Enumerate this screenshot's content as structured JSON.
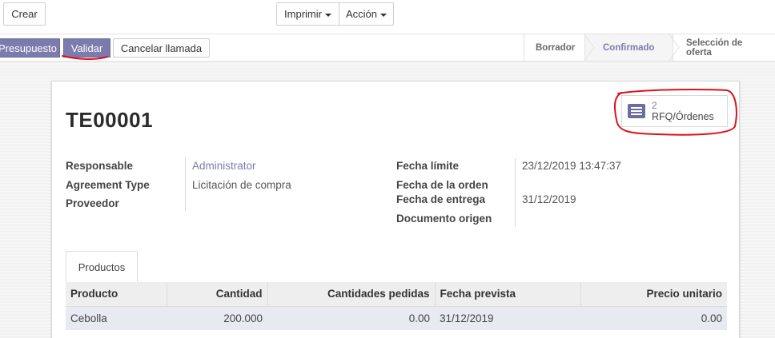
{
  "toolbar": {
    "create_label": "Crear",
    "print_label": "Imprimir",
    "action_label": "Acción"
  },
  "statusbar": {
    "quote_label": "Presupuesto",
    "validate_label": "Validar",
    "cancel_label": "Cancelar llamada",
    "stages": [
      {
        "label": "Borrador",
        "active": false
      },
      {
        "label": "Confirmado",
        "active": true
      },
      {
        "label": "Selección de oferta",
        "active": false
      }
    ]
  },
  "record": {
    "name": "TE00001",
    "smart_button": {
      "count": "2",
      "label": "RFQ/Órdenes",
      "icon": "list-icon"
    },
    "left_fields": [
      {
        "label": "Responsable",
        "value": "Administrator"
      },
      {
        "label": "Agreement Type",
        "value": "Licitación de compra"
      },
      {
        "label": "Proveedor",
        "value": ""
      }
    ],
    "right_fields": [
      {
        "label": "Fecha límite",
        "value": "23/12/2019 13:47:37"
      },
      {
        "label": "Fecha de la orden",
        "value": ""
      },
      {
        "label": "Fecha de entrega",
        "value": "31/12/2019"
      },
      {
        "label": "Documento origen",
        "value": ""
      }
    ]
  },
  "tabs": [
    {
      "label": "Productos"
    }
  ],
  "lines": {
    "columns": [
      "Producto",
      "Cantidad",
      "Cantidades pedidas",
      "Fecha prevista",
      "Precio unitario"
    ],
    "rows": [
      [
        "Cebolla",
        "200.000",
        "0.00",
        "31/12/2019",
        "0.00"
      ]
    ]
  },
  "colors": {
    "brand": "#7c7bad",
    "annotation": "#e0101a"
  }
}
